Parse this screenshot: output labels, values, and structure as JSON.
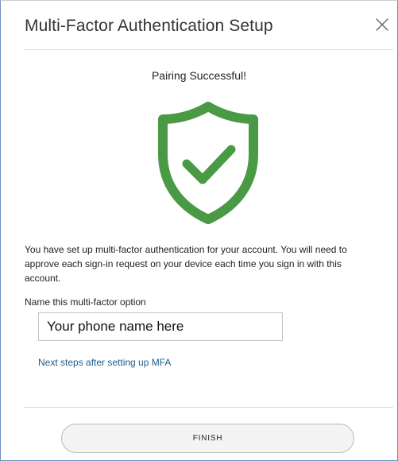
{
  "dialog": {
    "title": "Multi-Factor Authentication Setup",
    "close_icon": "close-icon",
    "status_text": "Pairing Successful!",
    "shield_icon": "shield-check-icon",
    "description": "You have set up multi-factor authentication for your account. You will need to approve each sign-in request on your device each time you sign in with this account.",
    "name_label": "Name this multi-factor option",
    "name_value": "Your phone name here",
    "next_steps_link": "Next steps after setting up MFA",
    "finish_label": "FINISH"
  },
  "colors": {
    "shield_green": "#4a9a45",
    "link_blue": "#1f5c8a",
    "border_blue": "#6f8fc4"
  }
}
